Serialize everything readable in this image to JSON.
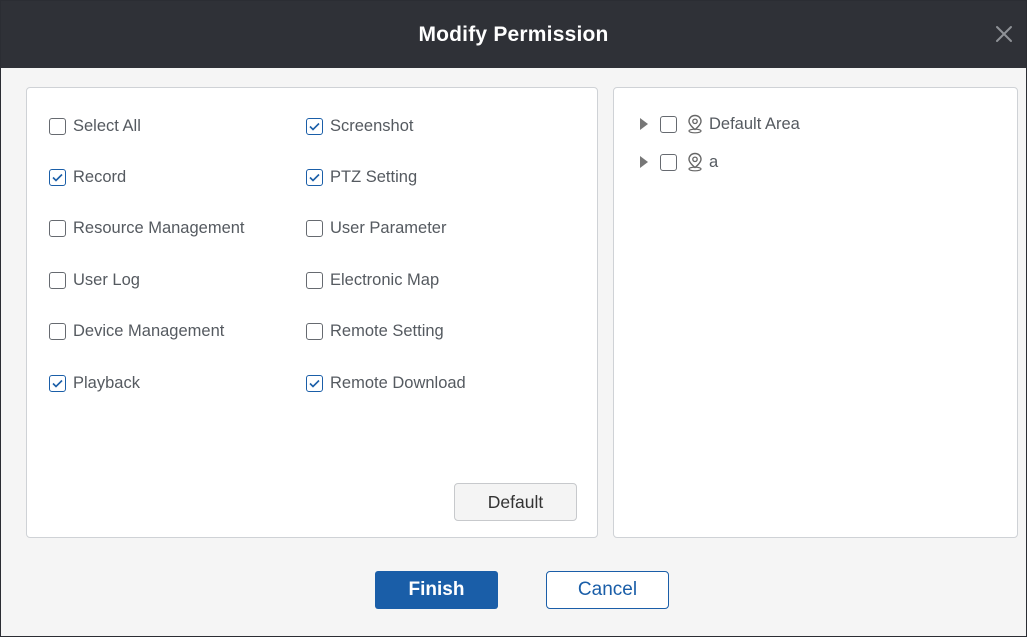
{
  "dialog": {
    "title": "Modify Permission"
  },
  "permissions": {
    "left_column": [
      {
        "label": "Select All",
        "checked": false
      },
      {
        "label": "Record",
        "checked": true
      },
      {
        "label": "Resource Management",
        "checked": false
      },
      {
        "label": "User Log",
        "checked": false
      },
      {
        "label": "Device Management",
        "checked": false
      },
      {
        "label": "Playback",
        "checked": true
      }
    ],
    "right_column": [
      {
        "label": "Screenshot",
        "checked": true
      },
      {
        "label": "PTZ Setting",
        "checked": true
      },
      {
        "label": "User Parameter",
        "checked": false
      },
      {
        "label": "Electronic Map",
        "checked": false
      },
      {
        "label": "Remote Setting",
        "checked": false
      },
      {
        "label": "Remote Download",
        "checked": true
      }
    ],
    "default_label": "Default"
  },
  "area_tree": {
    "items": [
      {
        "label": "Default Area",
        "checked": false,
        "expanded": false,
        "icon": "location-pin-icon"
      },
      {
        "label": "a",
        "checked": false,
        "expanded": false,
        "icon": "location-pin-icon"
      }
    ]
  },
  "footer": {
    "finish_label": "Finish",
    "cancel_label": "Cancel"
  },
  "colors": {
    "titlebar": "#2f3137",
    "accent": "#1a5ea8",
    "panel_border": "#cfd2d6",
    "text": "#555a60"
  }
}
